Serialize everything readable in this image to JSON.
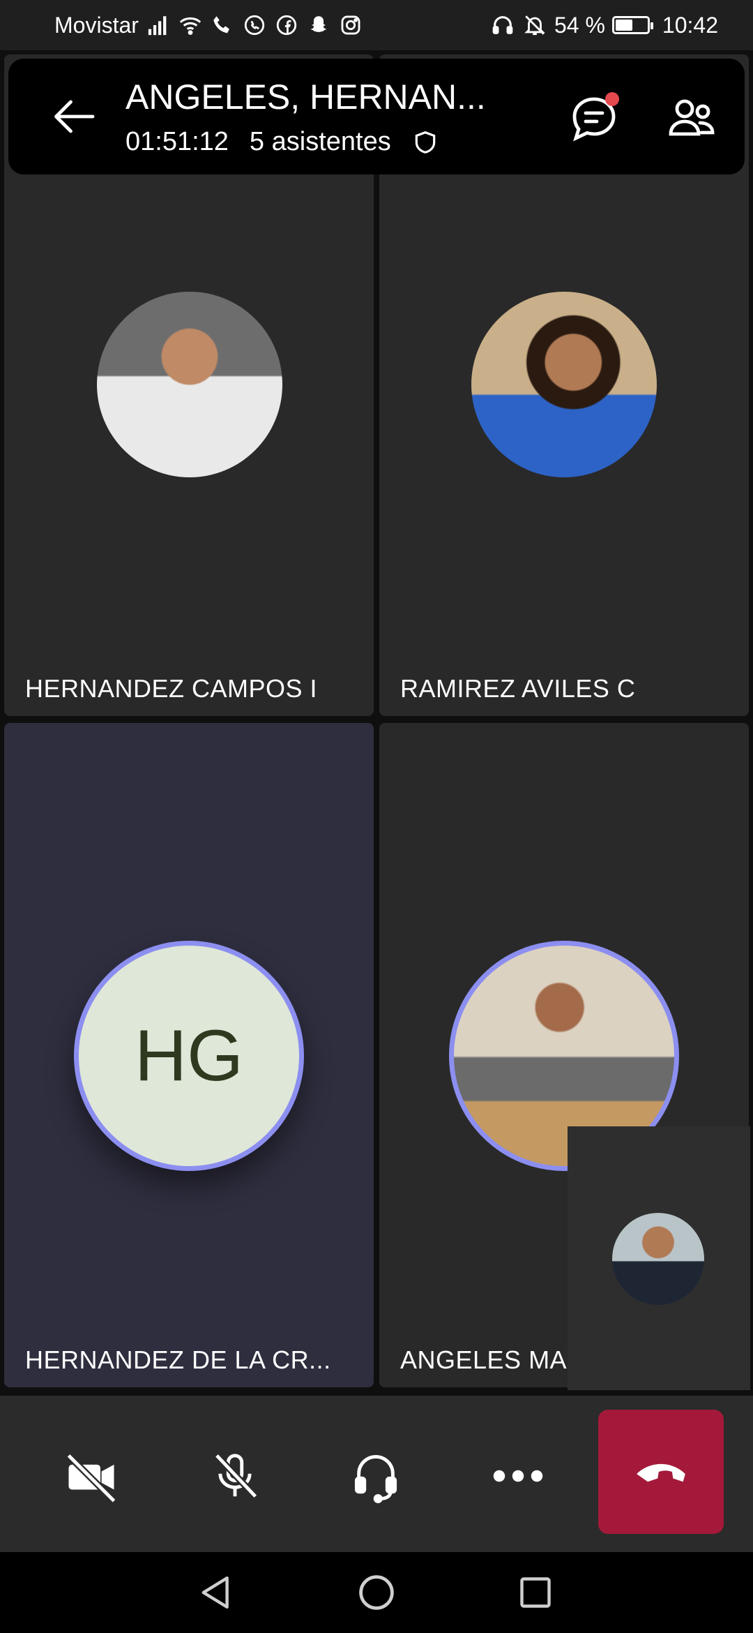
{
  "status_bar": {
    "carrier": "Movistar",
    "battery_percent": "54 %",
    "battery_level": 0.54,
    "time": "10:42"
  },
  "header": {
    "title": "ANGELES, HERNAN...",
    "duration": "01:51:12",
    "attendees": "5 asistentes"
  },
  "participants": [
    {
      "name": "HERNANDEZ CAMPOS I"
    },
    {
      "name": "RAMIREZ AVILES C"
    },
    {
      "name": "HERNANDEZ DE LA CR...",
      "initials": "HG"
    },
    {
      "name": "ANGELES MA"
    }
  ],
  "colors": {
    "accent_ring": "#8c8ff0",
    "hangup": "#a4193a",
    "notification_dot": "#e5484d"
  },
  "controls": [
    "camera-off-icon",
    "mic-off-icon",
    "headset-icon",
    "more-icon",
    "hangup-icon"
  ]
}
